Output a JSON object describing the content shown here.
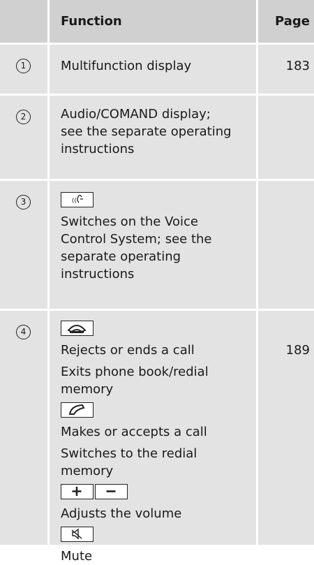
{
  "header": {
    "function": "Function",
    "page": "Page"
  },
  "rows": [
    {
      "num": "1",
      "lines": [
        "Multifunction display"
      ],
      "page": "183"
    },
    {
      "num": "2",
      "lines": [
        "Audio/COMAND display; see the separate operating instructions"
      ],
      "page": ""
    },
    {
      "num": "3",
      "key_icon": "voice-control-key-icon",
      "lines": [
        "Switches on the Voice Control System; see the separate operating instructions"
      ],
      "page": ""
    },
    {
      "num": "4",
      "keys": [
        {
          "icon": "end-call-key-icon",
          "texts": [
            "Rejects or ends a call",
            "Exits phone book/redial memory"
          ],
          "page": "189"
        },
        {
          "icon": "accept-call-key-icon",
          "texts": [
            "Makes or accepts a call",
            "Switches to the redial memory"
          ]
        },
        {
          "icon": "volume-plus-minus-keys-icon",
          "texts": [
            "Adjusts the volume"
          ]
        },
        {
          "icon": "mute-key-icon",
          "texts": [
            "Mute"
          ]
        }
      ]
    }
  ]
}
